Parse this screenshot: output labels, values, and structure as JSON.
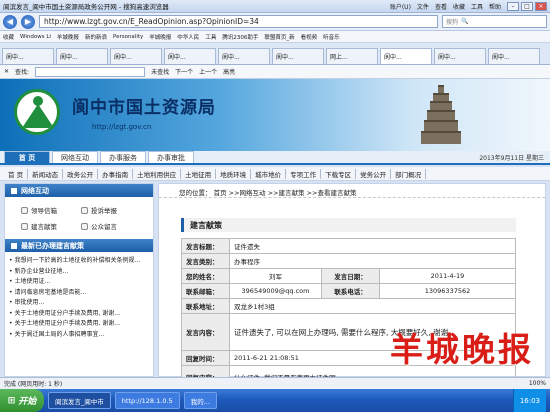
{
  "browser": {
    "title": "阆滨发言_阆中市国土资源局政务公开网 - 搜狗高速浏览器",
    "menu": [
      "账户(U)",
      "文件",
      "查看",
      "收藏",
      "工具",
      "帮助"
    ],
    "url": "http://www.lzgt.gov.cn/E_ReadOpinion.asp?OpinionID=34",
    "search_engine": "搜狗",
    "favorites": [
      "收藏",
      "Windows Li",
      "羊城晚报",
      "新的新浪",
      "Personality",
      "羊城晚报",
      "中华人民",
      "工具",
      "腾讯2306助手",
      "联盟首页_新",
      "看视频",
      "听音乐"
    ],
    "tabs": [
      "阆中...",
      "阆中...",
      "阆中...",
      "阆中...",
      "阆中...",
      "阆中...",
      "网上...",
      "阆中...",
      "阆中...",
      "阆中..."
    ],
    "find": {
      "label": "查找:",
      "prev": "上一个",
      "next": "下一个",
      "highlight": "高亮",
      "no_match": "未查找"
    }
  },
  "site": {
    "name": "阆中市国土资源局",
    "url": "http://lzgt.gov.cn",
    "nav_tabs": [
      "首 页",
      "网络互动",
      "办事服务",
      "办事审批"
    ],
    "date": "2013年9月11日 星期三",
    "subnav": [
      "首 页",
      "新闻动态",
      "政务公开",
      "办事指南",
      "土地利用供应",
      "土地征用",
      "地质环境",
      "城市地价",
      "专项工作",
      "下载专区",
      "党务公开",
      "部门概况"
    ]
  },
  "left": {
    "interaction_title": "网络互动",
    "interaction_items": [
      "领导信箱",
      "投诉举报",
      "建言献策",
      "公众留言"
    ],
    "latest_title": "最新已办理建言献策",
    "latest_items": [
      "我想问一下於高的土地征收的补偿相关条例规...",
      "新办企业营业征地...",
      "土地使用证...",
      "请问临息房宅基地是否能...",
      "审批使用...",
      "关于土地使用证分户手续及费用, 谢谢...",
      "关于土地使用证分户手续及费用, 谢谢...",
      "关于阆迁国土局的人事招聘事宜..."
    ]
  },
  "content": {
    "breadcrumb": "您的位置： 首页 >>网络互动 >>建言献策 >>查看建言献策",
    "section_title": "建言献策",
    "rows": {
      "topic_label": "发言标题：",
      "topic": "证件遗失",
      "type_label": "发言类别：",
      "type": "办事程序",
      "name_label": "您的姓名：",
      "name": "刘军",
      "date_label": "发言日期：",
      "date": "2011-4-19",
      "email_label": "联系邮箱：",
      "email": "396549009@qq.com",
      "phone_label": "联系电话：",
      "phone": "13096337562",
      "addr_label": "联系地址：",
      "addr": "双龙乡1村3组",
      "content_label": "发言内容：",
      "content": "证件遗失了, 可以在网上办理吗, 需要什么程序, 大概要好久, 谢谢",
      "reply_time_label": "回复时间：",
      "reply_time": "2011-6-21 21:08:51",
      "reply_label": "回复内容：",
      "reply": "什么证件, 我们不是东南更办证件明"
    }
  },
  "watermark": "羊城晚报",
  "statusbar": {
    "text": "完成 (网页用时: 1 秒)",
    "zoom": "100%"
  },
  "taskbar": {
    "start": "开始",
    "tasks": [
      "阆滨发言_阆中市",
      "http://128.1.0.5",
      "我的..."
    ],
    "clock": "16:03"
  }
}
